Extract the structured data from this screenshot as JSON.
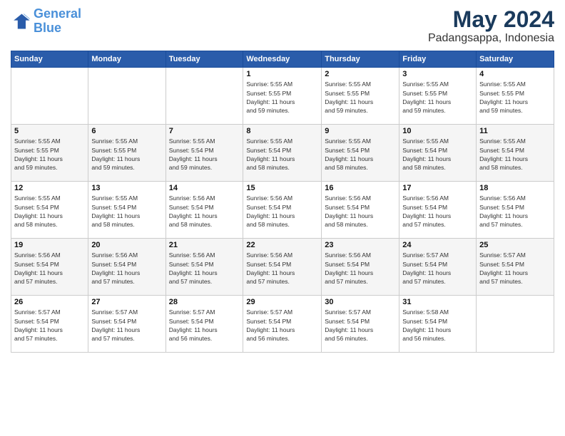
{
  "logo": {
    "line1": "General",
    "line2": "Blue"
  },
  "header": {
    "month": "May 2024",
    "location": "Padangsappa, Indonesia"
  },
  "weekdays": [
    "Sunday",
    "Monday",
    "Tuesday",
    "Wednesday",
    "Thursday",
    "Friday",
    "Saturday"
  ],
  "weeks": [
    [
      {
        "day": "",
        "info": ""
      },
      {
        "day": "",
        "info": ""
      },
      {
        "day": "",
        "info": ""
      },
      {
        "day": "1",
        "info": "Sunrise: 5:55 AM\nSunset: 5:55 PM\nDaylight: 11 hours\nand 59 minutes."
      },
      {
        "day": "2",
        "info": "Sunrise: 5:55 AM\nSunset: 5:55 PM\nDaylight: 11 hours\nand 59 minutes."
      },
      {
        "day": "3",
        "info": "Sunrise: 5:55 AM\nSunset: 5:55 PM\nDaylight: 11 hours\nand 59 minutes."
      },
      {
        "day": "4",
        "info": "Sunrise: 5:55 AM\nSunset: 5:55 PM\nDaylight: 11 hours\nand 59 minutes."
      }
    ],
    [
      {
        "day": "5",
        "info": "Sunrise: 5:55 AM\nSunset: 5:55 PM\nDaylight: 11 hours\nand 59 minutes."
      },
      {
        "day": "6",
        "info": "Sunrise: 5:55 AM\nSunset: 5:55 PM\nDaylight: 11 hours\nand 59 minutes."
      },
      {
        "day": "7",
        "info": "Sunrise: 5:55 AM\nSunset: 5:54 PM\nDaylight: 11 hours\nand 59 minutes."
      },
      {
        "day": "8",
        "info": "Sunrise: 5:55 AM\nSunset: 5:54 PM\nDaylight: 11 hours\nand 58 minutes."
      },
      {
        "day": "9",
        "info": "Sunrise: 5:55 AM\nSunset: 5:54 PM\nDaylight: 11 hours\nand 58 minutes."
      },
      {
        "day": "10",
        "info": "Sunrise: 5:55 AM\nSunset: 5:54 PM\nDaylight: 11 hours\nand 58 minutes."
      },
      {
        "day": "11",
        "info": "Sunrise: 5:55 AM\nSunset: 5:54 PM\nDaylight: 11 hours\nand 58 minutes."
      }
    ],
    [
      {
        "day": "12",
        "info": "Sunrise: 5:55 AM\nSunset: 5:54 PM\nDaylight: 11 hours\nand 58 minutes."
      },
      {
        "day": "13",
        "info": "Sunrise: 5:55 AM\nSunset: 5:54 PM\nDaylight: 11 hours\nand 58 minutes."
      },
      {
        "day": "14",
        "info": "Sunrise: 5:56 AM\nSunset: 5:54 PM\nDaylight: 11 hours\nand 58 minutes."
      },
      {
        "day": "15",
        "info": "Sunrise: 5:56 AM\nSunset: 5:54 PM\nDaylight: 11 hours\nand 58 minutes."
      },
      {
        "day": "16",
        "info": "Sunrise: 5:56 AM\nSunset: 5:54 PM\nDaylight: 11 hours\nand 58 minutes."
      },
      {
        "day": "17",
        "info": "Sunrise: 5:56 AM\nSunset: 5:54 PM\nDaylight: 11 hours\nand 57 minutes."
      },
      {
        "day": "18",
        "info": "Sunrise: 5:56 AM\nSunset: 5:54 PM\nDaylight: 11 hours\nand 57 minutes."
      }
    ],
    [
      {
        "day": "19",
        "info": "Sunrise: 5:56 AM\nSunset: 5:54 PM\nDaylight: 11 hours\nand 57 minutes."
      },
      {
        "day": "20",
        "info": "Sunrise: 5:56 AM\nSunset: 5:54 PM\nDaylight: 11 hours\nand 57 minutes."
      },
      {
        "day": "21",
        "info": "Sunrise: 5:56 AM\nSunset: 5:54 PM\nDaylight: 11 hours\nand 57 minutes."
      },
      {
        "day": "22",
        "info": "Sunrise: 5:56 AM\nSunset: 5:54 PM\nDaylight: 11 hours\nand 57 minutes."
      },
      {
        "day": "23",
        "info": "Sunrise: 5:56 AM\nSunset: 5:54 PM\nDaylight: 11 hours\nand 57 minutes."
      },
      {
        "day": "24",
        "info": "Sunrise: 5:57 AM\nSunset: 5:54 PM\nDaylight: 11 hours\nand 57 minutes."
      },
      {
        "day": "25",
        "info": "Sunrise: 5:57 AM\nSunset: 5:54 PM\nDaylight: 11 hours\nand 57 minutes."
      }
    ],
    [
      {
        "day": "26",
        "info": "Sunrise: 5:57 AM\nSunset: 5:54 PM\nDaylight: 11 hours\nand 57 minutes."
      },
      {
        "day": "27",
        "info": "Sunrise: 5:57 AM\nSunset: 5:54 PM\nDaylight: 11 hours\nand 57 minutes."
      },
      {
        "day": "28",
        "info": "Sunrise: 5:57 AM\nSunset: 5:54 PM\nDaylight: 11 hours\nand 56 minutes."
      },
      {
        "day": "29",
        "info": "Sunrise: 5:57 AM\nSunset: 5:54 PM\nDaylight: 11 hours\nand 56 minutes."
      },
      {
        "day": "30",
        "info": "Sunrise: 5:57 AM\nSunset: 5:54 PM\nDaylight: 11 hours\nand 56 minutes."
      },
      {
        "day": "31",
        "info": "Sunrise: 5:58 AM\nSunset: 5:54 PM\nDaylight: 11 hours\nand 56 minutes."
      },
      {
        "day": "",
        "info": ""
      }
    ]
  ]
}
